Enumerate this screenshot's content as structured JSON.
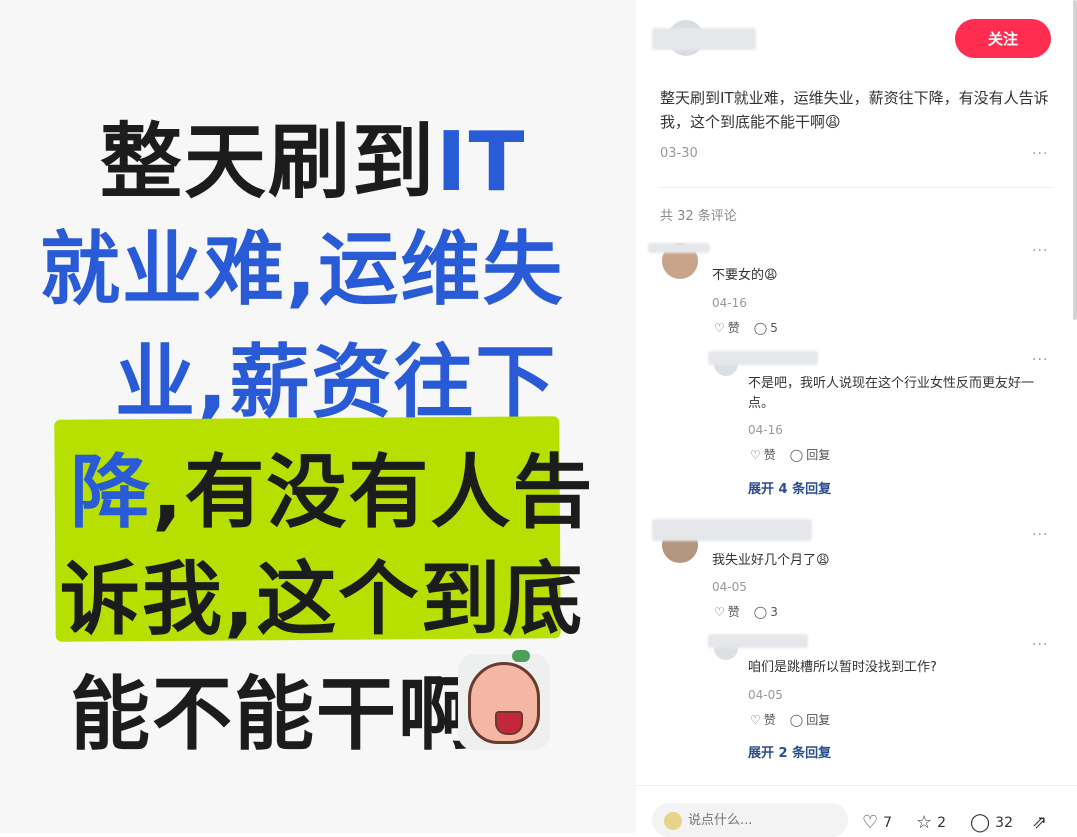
{
  "poster": {
    "line1_a": "整天刷到",
    "line1_b": "IT",
    "line2": "就业难,运维失",
    "line3": "业,薪资往下",
    "line4_a": "降",
    "line4_b": ",有没有人告",
    "line5": "诉我,这个到底",
    "line6": "能不能干啊",
    "highlight_color": "#b7e000",
    "blue": "#2a5bd6"
  },
  "author": {
    "follow_label": "关注"
  },
  "post": {
    "text": "整天刷到IT就业难，运维失业，薪资往下降，有没有人告诉我，这个到底能不能干啊😩",
    "date": "03-30",
    "more": "···"
  },
  "comments_count": "共 32 条评论",
  "comments": [
    {
      "text": "不要女的😩",
      "date": "04-16",
      "like_label": "赞",
      "reply_count": "5",
      "reply": {
        "text": "不是吧，我听人说现在这个行业女性反而更友好一点。",
        "date": "04-16",
        "like_label": "赞",
        "reply_label": "回复"
      },
      "expand": "展开 4 条回复"
    },
    {
      "text": "我失业好几个月了😩",
      "date": "04-05",
      "like_label": "赞",
      "reply_count": "3",
      "reply": {
        "text": "咱们是跳槽所以暂时没找到工作?",
        "date": "04-05",
        "like_label": "赞",
        "reply_label": "回复"
      },
      "expand": "展开 2 条回复"
    }
  ],
  "bottom": {
    "placeholder": "说点什么...",
    "likes": "7",
    "stars": "2",
    "comments": "32"
  },
  "colors": {
    "accent": "#ff2d4f",
    "link": "#2a4d8f"
  }
}
